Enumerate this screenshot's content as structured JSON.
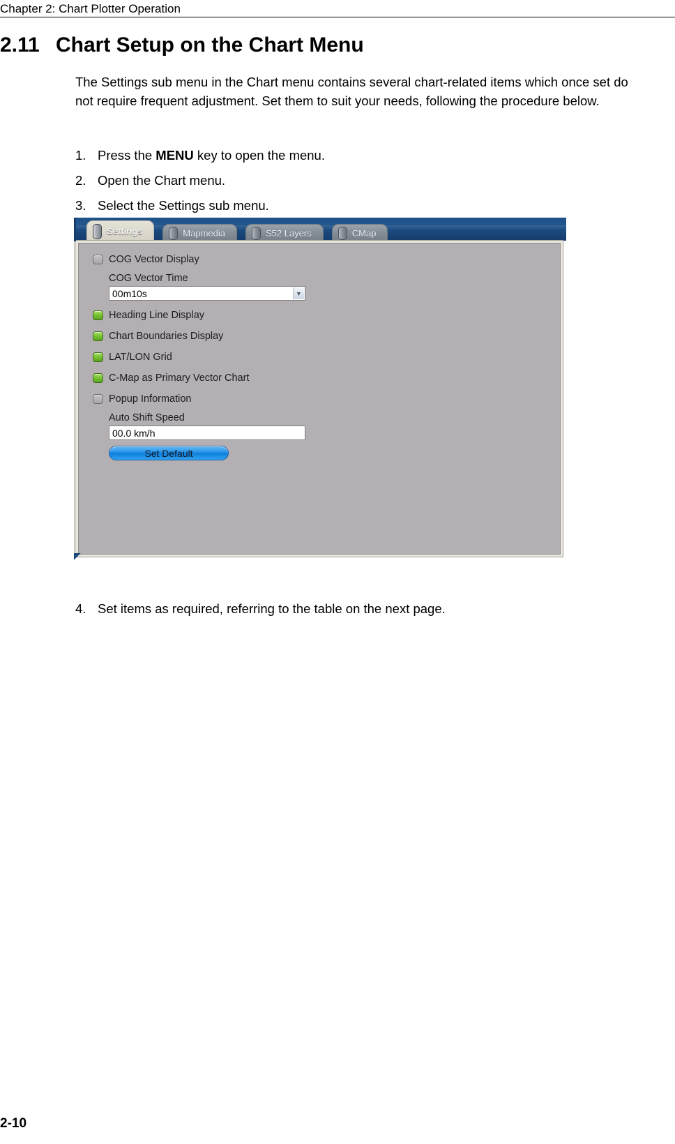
{
  "page": {
    "running_head": "Chapter 2: Chart Plotter Operation",
    "page_number": "2-10"
  },
  "section": {
    "number": "2.11",
    "title": "Chart Setup on the Chart Menu",
    "intro": "The Settings sub menu in the Chart menu contains several chart-related items which once set do not require frequent adjustment. Set them to suit your needs, following the procedure below."
  },
  "steps": [
    {
      "num": "1.",
      "pre": "Press the ",
      "strong": "MENU",
      "post": " key to open the menu."
    },
    {
      "num": "2.",
      "pre": "Open the Chart menu.",
      "strong": "",
      "post": ""
    },
    {
      "num": "3.",
      "pre": "Select the Settings sub menu.",
      "strong": "",
      "post": ""
    }
  ],
  "step_last": {
    "num": "4.",
    "text": "Set items as required, referring to the table on the next page."
  },
  "screenshot": {
    "tabs": [
      {
        "label": "Settings",
        "active": true
      },
      {
        "label": "Mapmedia",
        "active": false
      },
      {
        "label": "S52 Layers",
        "active": false
      },
      {
        "label": "CMap",
        "active": false
      }
    ],
    "items": [
      {
        "type": "checkbox",
        "label": "COG Vector Display",
        "checked": false
      },
      {
        "type": "combo",
        "label": "COG Vector Time",
        "value": "00m10s"
      },
      {
        "type": "checkbox",
        "label": "Heading Line Display",
        "checked": true
      },
      {
        "type": "checkbox",
        "label": "Chart Boundaries Display",
        "checked": true
      },
      {
        "type": "checkbox",
        "label": "LAT/LON Grid",
        "checked": true
      },
      {
        "type": "checkbox",
        "label": "C-Map as Primary Vector Chart",
        "checked": true
      },
      {
        "type": "checkbox",
        "label": "Popup Information",
        "checked": false
      },
      {
        "type": "textbox",
        "label": "Auto Shift Speed",
        "value": "00.0 km/h"
      },
      {
        "type": "button",
        "label": "Set Default"
      }
    ],
    "colors": {
      "titlebar": "#1b4a7f",
      "panel": "#b3afb3",
      "checkbox_on": "#7bc435",
      "button": "#2f9bec"
    }
  }
}
